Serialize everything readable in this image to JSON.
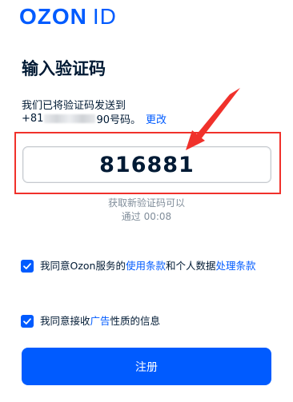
{
  "logo": {
    "brand": "OZON",
    "suffix": "ID"
  },
  "page_title": "输入验证码",
  "sent_text": "我们已将验证码发送到",
  "phone": {
    "prefix": "+81",
    "masked_part": "",
    "suffix": "90号码。",
    "change_label": "更改"
  },
  "code_input": {
    "value": "816881"
  },
  "resend": {
    "line1": "获取新验证码可以",
    "line2": "通过 00:08"
  },
  "consent_terms": {
    "text_before": "我同意Ozon服务的",
    "terms_link": "使用条款",
    "text_middle": "和个人数据",
    "processing_link": "处理条款"
  },
  "consent_ads": {
    "text_before": "我同意接收",
    "ads_link": "广告",
    "text_after": "性质的信息"
  },
  "register_button": {
    "label": "注册"
  },
  "colors": {
    "brand_blue": "#005bff",
    "highlight_red": "#f0312b",
    "text_dark": "#001a34",
    "text_muted": "#808d9a"
  }
}
